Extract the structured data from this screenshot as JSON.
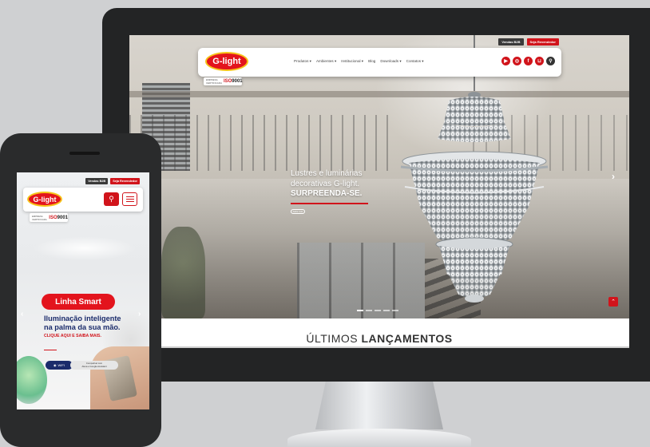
{
  "desktop": {
    "top_buttons": {
      "b2b": "Vendas B2B",
      "reseller": "Seja Revendedor"
    },
    "logo_text": "G-light",
    "nav": [
      "Produtos ▾",
      "Ambientes ▾",
      "Institucional ▾",
      "Blog",
      "Downloads ▾",
      "Contatos ▾"
    ],
    "social_icons": [
      "youtube-icon",
      "instagram-icon",
      "facebook-icon",
      "cart-icon",
      "search-icon"
    ],
    "iso": {
      "small": "EMPRESA CERTIFICADA",
      "iso_prefix": "ISO",
      "iso_number": "9001"
    },
    "slide": {
      "line1": "Lustres e luminárias",
      "line2": "decorativas G-light.",
      "line3": "SURPREENDA-SE.",
      "cta": "Saiba mais"
    },
    "arrows": {
      "prev": "‹",
      "next": "›"
    },
    "scroll_top": "⌃",
    "section_title_light": "ÚLTIMOS ",
    "section_title_bold": "LANÇAMENTOS"
  },
  "mobile": {
    "top_buttons": {
      "b2b": "Vendas B2B",
      "reseller": "Seja Revendedor"
    },
    "logo_text": "G-light",
    "search_icon": "⚲",
    "iso": {
      "small": "EMPRESA CERTIFICADA",
      "iso_prefix": "ISO",
      "iso_number": "9001"
    },
    "pill": "Linha Smart",
    "headline1": "Iluminação inteligente",
    "headline2": "na palma da sua mão.",
    "cta": "CLIQUE AQUI E SAIBA MAIS.",
    "wifi_label": "WIFI",
    "compat1": "Compatível com",
    "compat2": "Alexa e Google Assistant",
    "arrows": {
      "prev": "‹",
      "next": "›"
    }
  },
  "colors": {
    "brand_red": "#d1141b",
    "brand_yellow": "#f6c41a",
    "navy": "#1a2b6b"
  }
}
